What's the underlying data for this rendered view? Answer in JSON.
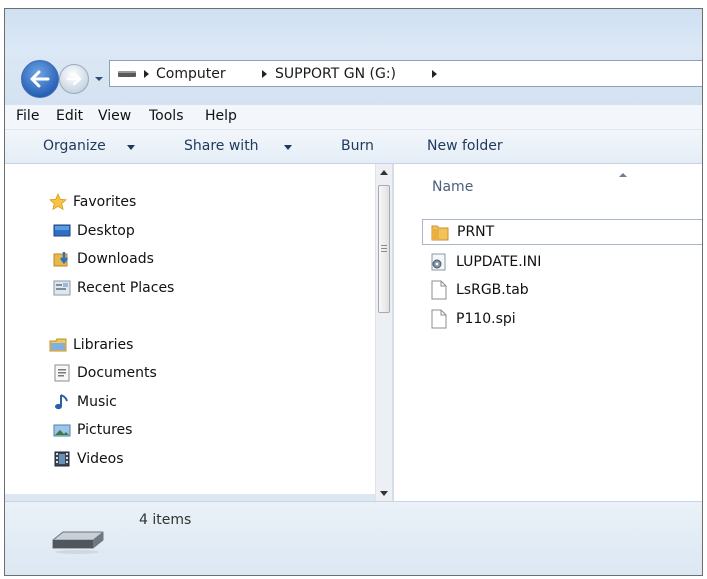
{
  "address": {
    "segments": [
      "Computer",
      "SUPPORT GN (G:)"
    ]
  },
  "menu": [
    "File",
    "Edit",
    "View",
    "Tools",
    "Help"
  ],
  "toolbar": {
    "organize": "Organize",
    "share_with": "Share with",
    "burn": "Burn",
    "new_folder": "New folder"
  },
  "navigation": {
    "favorites_header": "Favorites",
    "favorites": [
      "Desktop",
      "Downloads",
      "Recent Places"
    ],
    "libraries_header": "Libraries",
    "libraries": [
      "Documents",
      "Music",
      "Pictures",
      "Videos"
    ]
  },
  "content": {
    "column_name": "Name",
    "items": [
      {
        "name": "PRNT",
        "icon": "folder-icon"
      },
      {
        "name": "LUPDATE.INI",
        "icon": "settings-file-icon"
      },
      {
        "name": "LsRGB.tab",
        "icon": "file-icon"
      },
      {
        "name": "P110.spi",
        "icon": "file-icon"
      }
    ]
  },
  "status": {
    "item_count": "4 items"
  },
  "colors": {
    "accent": "#2a62b7",
    "window_frame": "#dce7f2",
    "toolbar_text": "#1e395b"
  }
}
